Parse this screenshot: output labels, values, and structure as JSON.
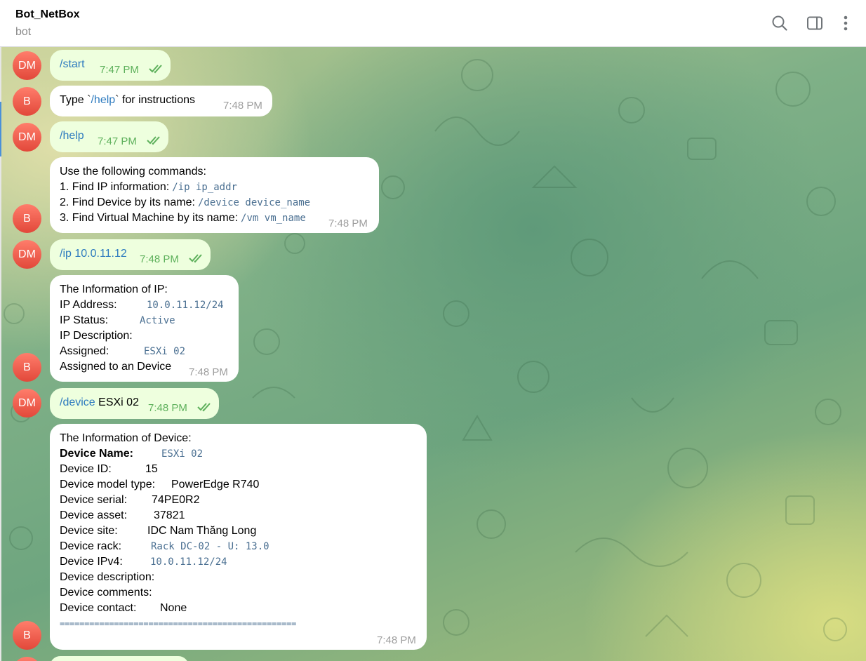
{
  "header": {
    "title": "Bot_NetBox",
    "subtitle": "bot"
  },
  "avatars": {
    "user": "DM",
    "bot": "B"
  },
  "messages": {
    "m1": {
      "text": "/start",
      "time": "7:47 PM"
    },
    "m2": {
      "pre": "Type `",
      "cmd": "/help",
      "post": "` for instructions",
      "time": "7:48 PM"
    },
    "m3": {
      "text": "/help",
      "time": "7:47 PM"
    },
    "m4": {
      "title": "Use the following commands:",
      "l1": "1. Find IP information: ",
      "c1": "/ip ip_addr",
      "l2": "2. Find Device by its name: ",
      "c2": "/device device_name",
      "l3": "3. Find Virtual Machine by its name: ",
      "c3": "/vm vm_name",
      "time": "7:48 PM"
    },
    "m5": {
      "cmd": "/ip",
      "arg": " 10.0.11.12",
      "time": "7:48 PM"
    },
    "m6": {
      "title": "The Information of IP:",
      "rows": [
        {
          "label": "IP Address:",
          "value": "10.0.11.12/24"
        },
        {
          "label": "IP Status:",
          "value": "Active"
        },
        {
          "label": "IP Description:",
          "value": ""
        },
        {
          "label": "Assigned:",
          "value": "ESXi 02"
        }
      ],
      "last": "Assigned to an Device",
      "time": "7:48 PM"
    },
    "m7": {
      "cmd": "/device",
      "arg": " ESXi 02",
      "time": "7:48 PM"
    },
    "m8": {
      "title": "The Information of Device:",
      "rows": [
        {
          "label": "Device Name:",
          "value": "ESXi 02"
        },
        {
          "label": "Device ID:",
          "value": "15"
        },
        {
          "label": "Device model type:",
          "value": "PowerEdge R740"
        },
        {
          "label": "Device serial:",
          "value": "74PE0R2"
        },
        {
          "label": "Device asset:",
          "value": "37821"
        },
        {
          "label": "Device site:",
          "value": "IDC Nam Thăng Long"
        },
        {
          "label": "Device rack:",
          "value": "Rack DC-02 - U: 13.0"
        },
        {
          "label": "Device IPv4:",
          "value": "10.0.11.12/24"
        },
        {
          "label": "Device description:",
          "value": ""
        },
        {
          "label": "Device comments:",
          "value": ""
        },
        {
          "label": "Device contact:",
          "value": "None"
        }
      ],
      "separator": "================================================",
      "time": "7:48 PM"
    }
  }
}
